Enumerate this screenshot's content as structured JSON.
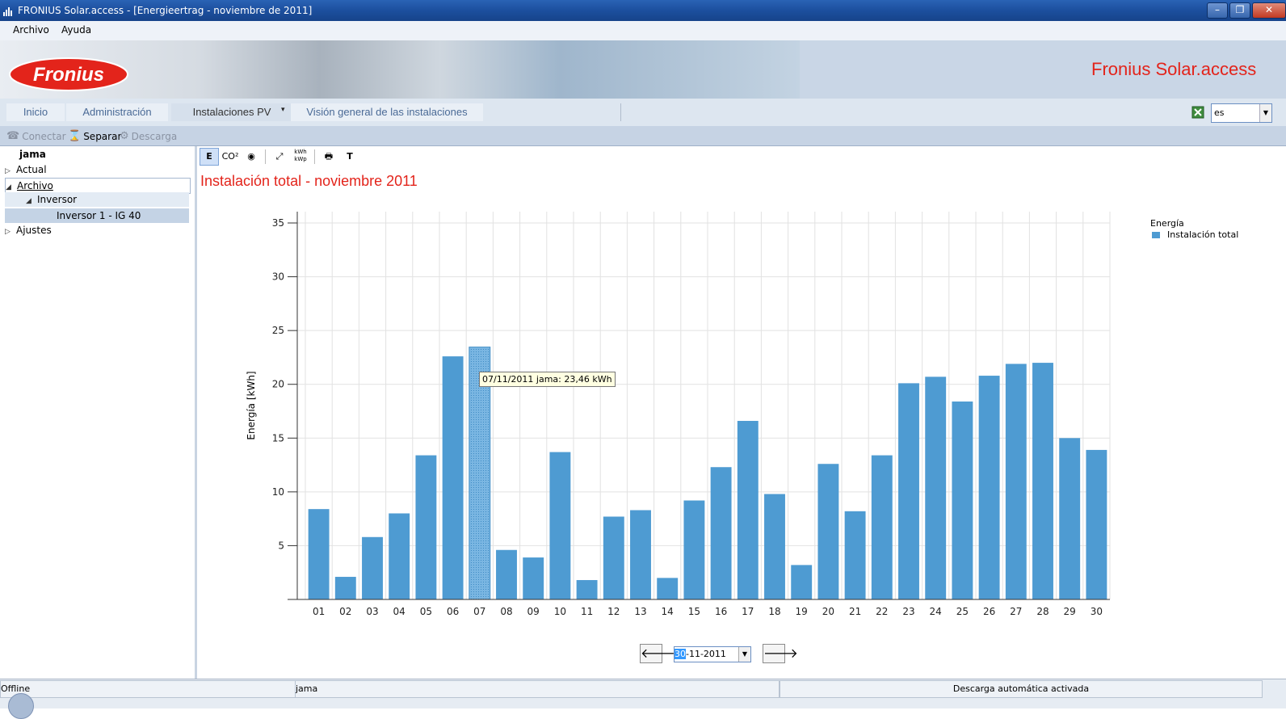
{
  "window": {
    "title": "FRONIUS Solar.access - [Energieertrag - noviembre de 2011]",
    "min_glyph": "–",
    "max_glyph": "❐",
    "close_glyph": "✕"
  },
  "menu": {
    "archivo": "Archivo",
    "ayuda": "Ayuda"
  },
  "banner": {
    "logo_text": "Fronius",
    "app_title": "Fronius Solar.access"
  },
  "nav": {
    "tabs": [
      "Inicio",
      "Administración",
      "Instalaciones PV",
      "Visión general de las instalaciones"
    ],
    "dropdown_glyph": "▾"
  },
  "language": {
    "value": "es"
  },
  "toolbar": {
    "connect": "Conectar",
    "separate": "Separar",
    "download": "Descarga"
  },
  "tree": {
    "root": "jama",
    "items": [
      "Actual",
      "Archivo",
      "Inversor",
      "Inversor 1 - IG 40",
      "Ajustes"
    ]
  },
  "chart_tools": {
    "energy": "E",
    "co2": "CO²",
    "text": "T"
  },
  "chart_data": {
    "type": "bar",
    "title": "Instalación total - noviembre 2011",
    "ylabel": "Energía [kWh]",
    "xlabel": "",
    "ylim": [
      0,
      35
    ],
    "yticks": [
      5,
      10,
      15,
      20,
      25,
      30,
      35
    ],
    "grid": true,
    "legend_position": "top-right",
    "legend_title": "Energía",
    "categories": [
      "01",
      "02",
      "03",
      "04",
      "05",
      "06",
      "07",
      "08",
      "09",
      "10",
      "11",
      "12",
      "13",
      "14",
      "15",
      "16",
      "17",
      "18",
      "19",
      "20",
      "21",
      "22",
      "23",
      "24",
      "25",
      "26",
      "27",
      "28",
      "29",
      "30"
    ],
    "series": [
      {
        "name": "Instalación total",
        "color": "#4e9bd2",
        "values": [
          8.4,
          2.1,
          5.8,
          8.0,
          13.4,
          22.6,
          23.46,
          4.6,
          3.9,
          13.7,
          1.8,
          7.7,
          8.3,
          2.0,
          9.2,
          12.3,
          16.6,
          9.8,
          3.2,
          12.6,
          8.2,
          13.4,
          20.1,
          20.7,
          18.4,
          20.8,
          21.9,
          22.0,
          15.0,
          13.9
        ]
      }
    ],
    "highlighted_category": "07",
    "tooltip": "07/11/2011 jama: 23,46 kWh"
  },
  "date_nav": {
    "prev_glyph": "🡐",
    "next_glyph": "🡒",
    "day": "30",
    "rest": "-11-2011"
  },
  "status": {
    "connection": "Offline",
    "user": "jama",
    "auto_download": "Descarga automática activada"
  }
}
